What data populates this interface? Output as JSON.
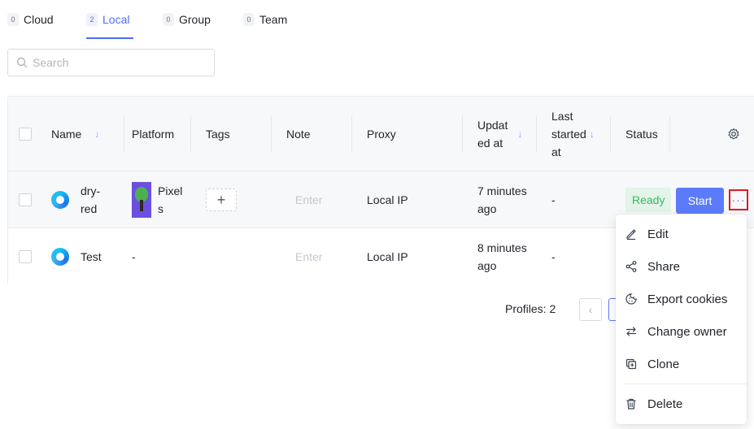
{
  "tabs": [
    {
      "count": "0",
      "label": "Cloud"
    },
    {
      "count": "2",
      "label": "Local"
    },
    {
      "count": "0",
      "label": "Group"
    },
    {
      "count": "0",
      "label": "Team"
    }
  ],
  "search": {
    "placeholder": "Search"
  },
  "table": {
    "headers": {
      "name": "Name",
      "platform": "Platform",
      "tags": "Tags",
      "note": "Note",
      "proxy": "Proxy",
      "updated_line1": "Updat",
      "updated_line2": "ed at",
      "last_line1": "Last",
      "last_line2": "started",
      "last_line3": "at",
      "status": "Status"
    },
    "rows": [
      {
        "name_line1": "dry-",
        "name_line2": "red",
        "platform_line1": "Pixel",
        "platform_line2": "s",
        "note_placeholder": "Enter",
        "proxy": "Local IP",
        "updated_line1": "7 minutes",
        "updated_line2": "ago",
        "last_started": "-",
        "status": "Ready",
        "action": "Start"
      },
      {
        "name": "Test",
        "platform": "-",
        "note_placeholder": "Enter",
        "proxy": "Local IP",
        "updated_line1": "8 minutes",
        "updated_line2": "ago",
        "last_started": "-"
      }
    ]
  },
  "footer": {
    "profiles": "Profiles: 2"
  },
  "menu": {
    "items": [
      "Edit",
      "Share",
      "Export cookies",
      "Change owner",
      "Clone",
      "Delete"
    ]
  },
  "colors": {
    "accent": "#5b7cfa",
    "ready_bg": "#e3f4e8",
    "ready_text": "#3fb46a",
    "highlight": "#e01b24"
  }
}
